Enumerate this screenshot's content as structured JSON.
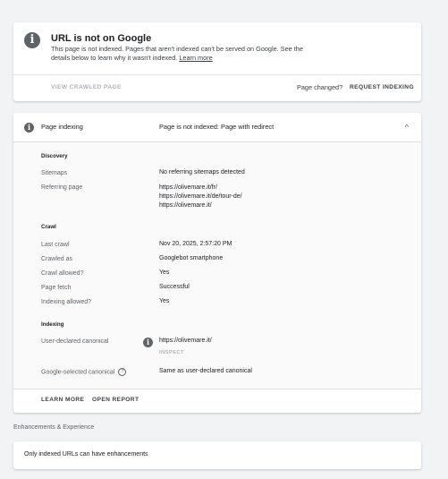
{
  "status_card": {
    "title": "URL is not on Google",
    "description": "This page is not indexed. Pages that aren't indexed can't be served on Google. See the details below to learn why it wasn't indexed.",
    "learn_more": "Learn more",
    "view_crawled": "VIEW CRAWLED PAGE",
    "page_changed": "Page changed?",
    "request_indexing": "REQUEST INDEXING"
  },
  "indexing_card": {
    "header_label": "Page indexing",
    "header_value": "Page is not indexed: Page with redirect",
    "discovery": {
      "title": "Discovery",
      "sitemaps_label": "Sitemaps",
      "sitemaps_value": "No referring sitemaps detected",
      "referring_label": "Referring page",
      "referring_values": [
        "https://olivemare.it/fr/",
        "https://olivemare.it/de/tour-de/",
        "https://olivemare.it/"
      ]
    },
    "crawl": {
      "title": "Crawl",
      "last_crawl_label": "Last crawl",
      "last_crawl_value": "Nov 20, 2025, 2:57:20 PM",
      "crawled_as_label": "Crawled as",
      "crawled_as_value": "Googlebot smartphone",
      "crawl_allowed_label": "Crawl allowed?",
      "crawl_allowed_value": "Yes",
      "page_fetch_label": "Page fetch",
      "page_fetch_value": "Successful",
      "indexing_allowed_label": "Indexing allowed?",
      "indexing_allowed_value": "Yes"
    },
    "indexing": {
      "title": "Indexing",
      "user_canonical_label": "User-declared canonical",
      "user_canonical_value": "https://olivemare.it/",
      "inspect": "INSPECT",
      "google_canonical_label": "Google-selected canonical",
      "google_canonical_value": "Same as user-declared canonical"
    },
    "learn_more": "LEARN MORE",
    "open_report": "OPEN REPORT"
  },
  "enhancements": {
    "label": "Enhancements & Experience",
    "message": "Only indexed URLs can have enhancements"
  },
  "icons": {
    "info": "i",
    "question": "?",
    "chevron_up": "^"
  }
}
